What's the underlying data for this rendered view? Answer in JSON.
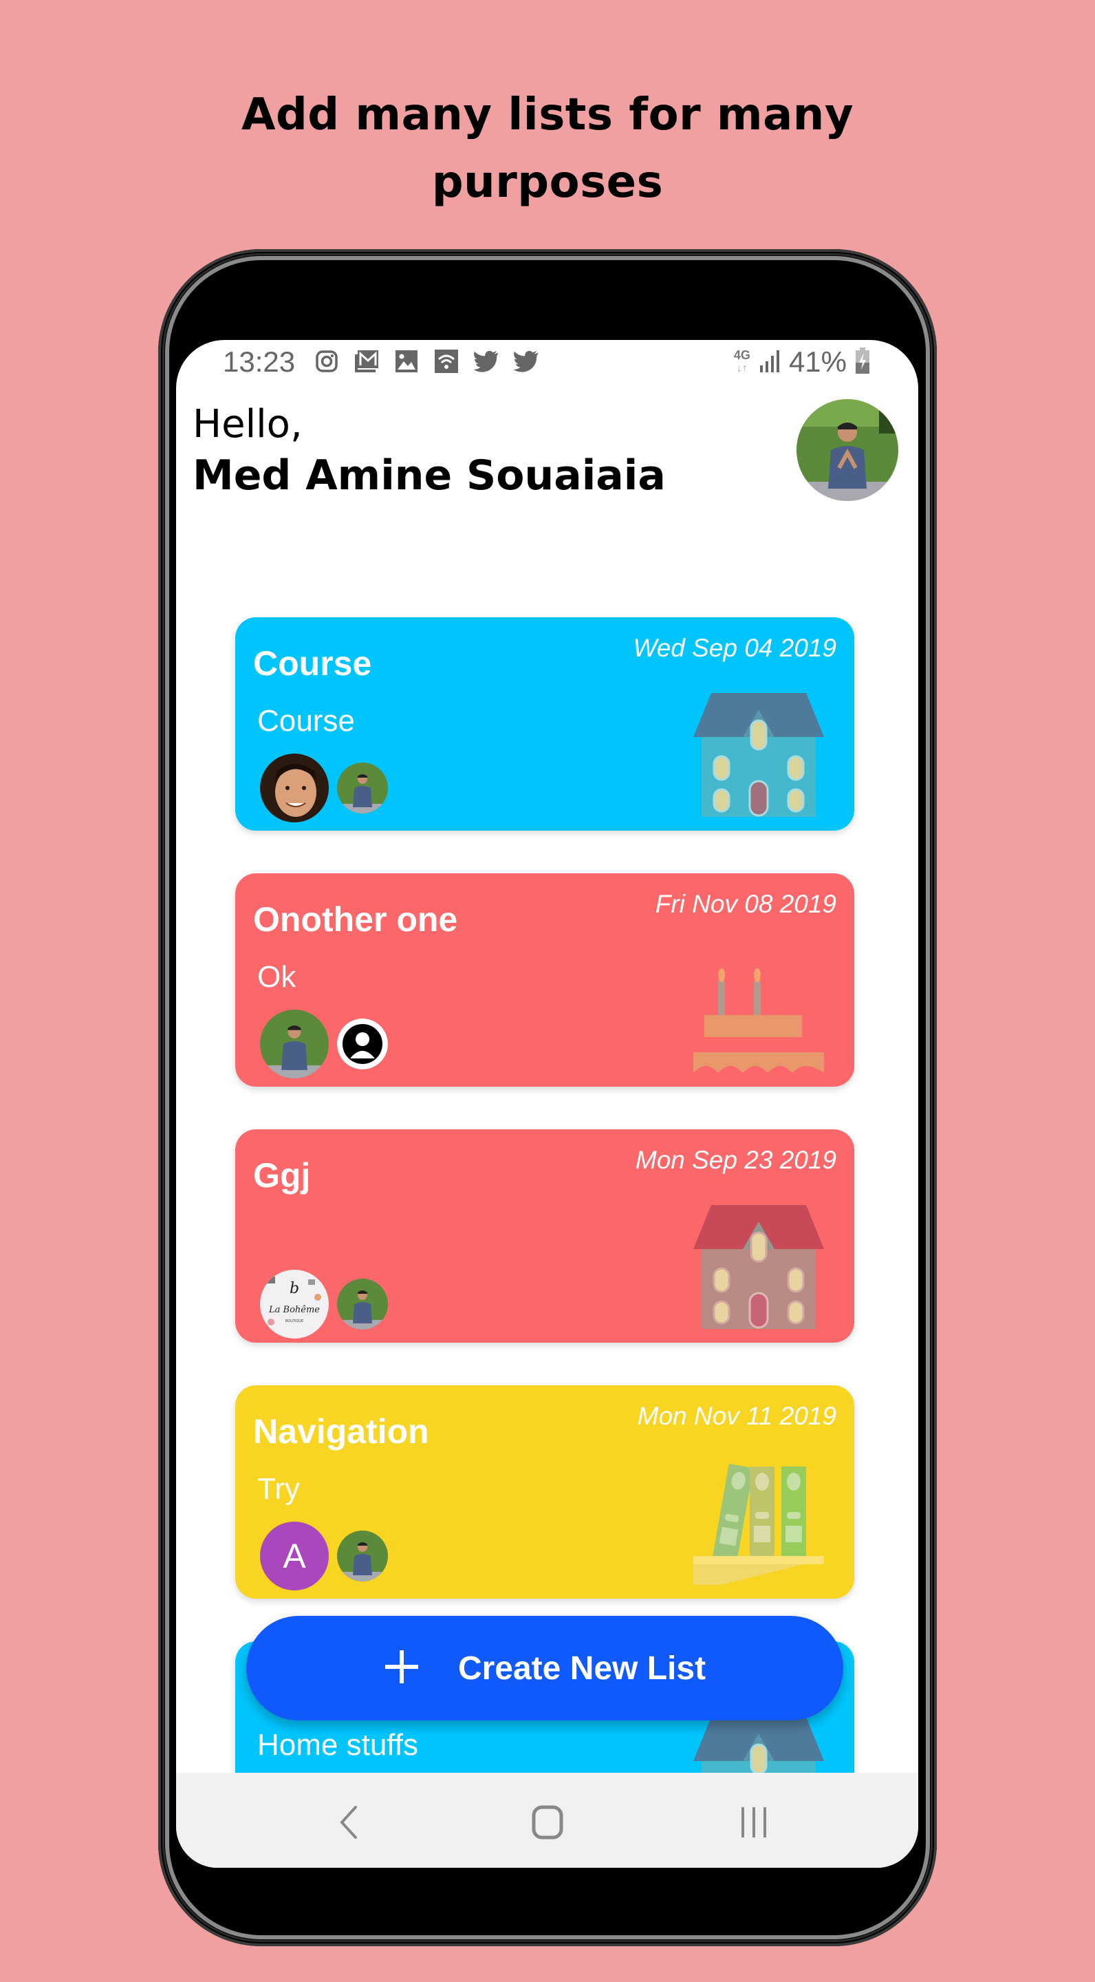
{
  "headline": {
    "line1": "Add many lists for many",
    "line2": "purposes"
  },
  "status_bar": {
    "time": "13:23",
    "notification_icons": [
      "instagram-icon",
      "gmail-icon",
      "gallery-icon",
      "wifi-icon",
      "twitter-icon",
      "twitter-icon"
    ],
    "network": "4G",
    "battery_percent": "41%",
    "charging": true
  },
  "greeting": {
    "hello": "Hello,",
    "user_name": "Med Amine Souaiaia"
  },
  "lists": [
    {
      "title": "Course",
      "date": "Wed Sep 04 2019",
      "description": "Course",
      "color": "#00c5fd",
      "illustration": "house-icon",
      "members": [
        "photo-man-smiling",
        "photo-user-grass"
      ]
    },
    {
      "title": "Onother one",
      "date": "Fri Nov 08 2019",
      "description": "Ok",
      "color": "#fc6869",
      "illustration": "birthday-cake-icon",
      "members": [
        "photo-user-grass",
        "default-user-icon"
      ]
    },
    {
      "title": "Ggj",
      "date": "Mon Sep 23 2019",
      "description": "",
      "color": "#fc6869",
      "illustration": "house-icon",
      "members": [
        "photo-la-boheme-logo",
        "photo-user-grass"
      ]
    },
    {
      "title": "Navigation",
      "date": "Mon Nov 11 2019",
      "description": "Try",
      "color": "#f8d523",
      "illustration": "binders-shelf-icon",
      "members": [
        "letter-avatar-A",
        "photo-user-grass"
      ]
    },
    {
      "title": "",
      "date": "",
      "description": "Home stuffs",
      "color": "#00c5fd",
      "illustration": "house-icon",
      "members": []
    }
  ],
  "letter_avatar": {
    "letter": "A",
    "color": "#ab47bc"
  },
  "la_boheme_text": "La Bohême",
  "fab": {
    "label": "Create New List",
    "icon": "plus-icon",
    "color": "#1059fb"
  },
  "nav_bar": {
    "buttons": [
      "back",
      "home",
      "recents"
    ]
  }
}
